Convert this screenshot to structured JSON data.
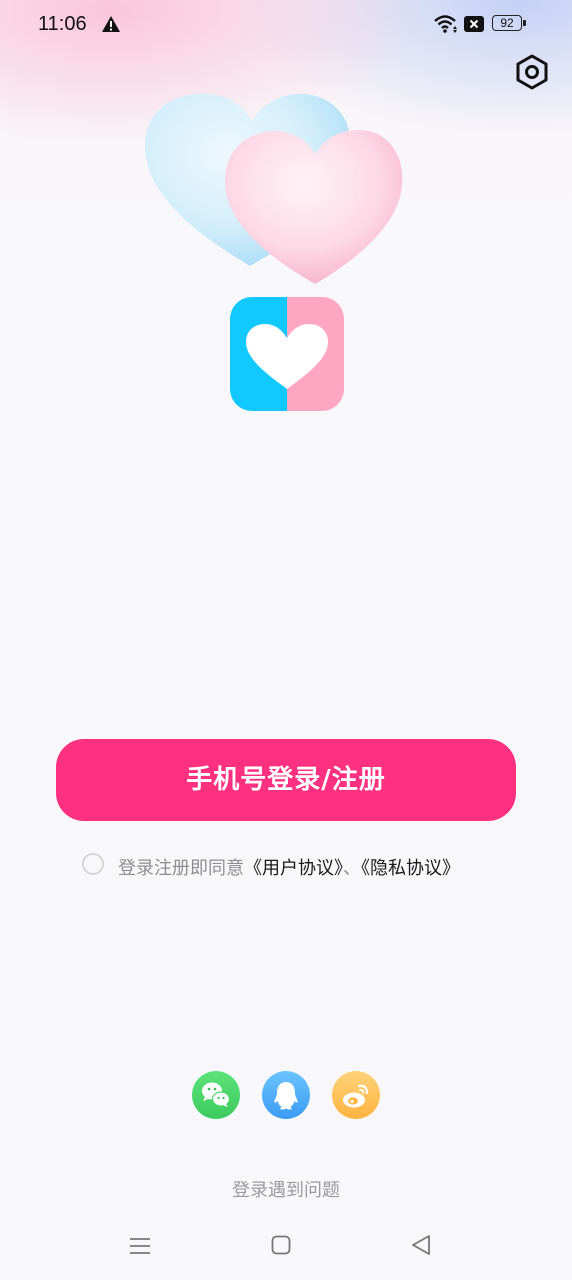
{
  "status_bar": {
    "time": "11:06",
    "battery_level": "92",
    "icons": [
      "alert-icon",
      "wifi-icon",
      "sim-disabled-icon",
      "battery-icon"
    ]
  },
  "header": {
    "settings_icon": "settings-hex-icon"
  },
  "illustration": {
    "icon": "twin-hearts-icon",
    "colors": {
      "blue_heart": "#c9ecfb",
      "pink_heart": "#fcd3e2"
    }
  },
  "app_logo": {
    "icon": "heart-logo-icon",
    "colors": {
      "left": "#12c9ff",
      "right": "#ffa6c3"
    }
  },
  "login": {
    "button_label": "手机号登录/注册",
    "button_color": "#fe3080"
  },
  "agreement": {
    "prefix": "登录注册即同意",
    "user_agreement": "《用户协议》",
    "separator": "、",
    "privacy_policy": "《隐私协议》",
    "checked": false
  },
  "social_login": {
    "items": [
      {
        "icon": "wechat-icon",
        "color": "#4cd964"
      },
      {
        "icon": "qq-icon",
        "color": "#4aa8f5"
      },
      {
        "icon": "weibo-icon",
        "color": "#ffc14d"
      }
    ]
  },
  "footer": {
    "help_label": "登录遇到问题"
  },
  "nav_bar": {
    "icons": [
      "menu-icon",
      "home-icon",
      "back-icon"
    ]
  }
}
